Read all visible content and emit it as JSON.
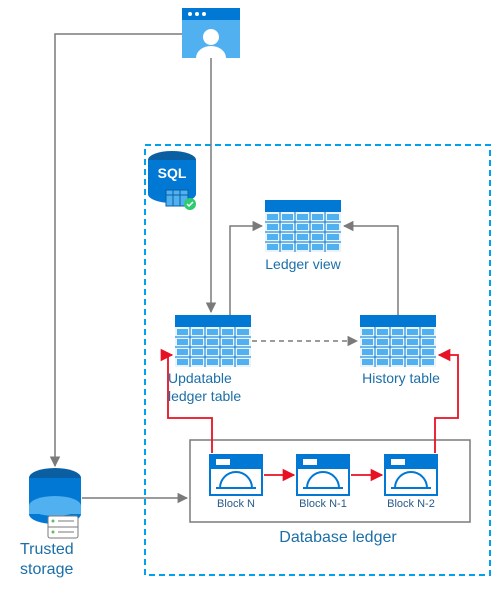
{
  "labels": {
    "trusted_storage": "Trusted\nstorage",
    "ledger_view": "Ledger view",
    "updatable_ledger_table": "Updatable\nledger table",
    "history_table": "History table",
    "database_ledger": "Database ledger",
    "sql_badge": "SQL"
  },
  "blocks": {
    "b0": "Block N",
    "b1": "Block N-1",
    "b2": "Block N-2"
  },
  "colors": {
    "azure_blue": "#0078D4",
    "light_blue": "#50B0F0",
    "label_blue": "#1b6fa8",
    "grey": "#7a7a7a",
    "red": "#e81123",
    "dash": "#00A2ED"
  }
}
